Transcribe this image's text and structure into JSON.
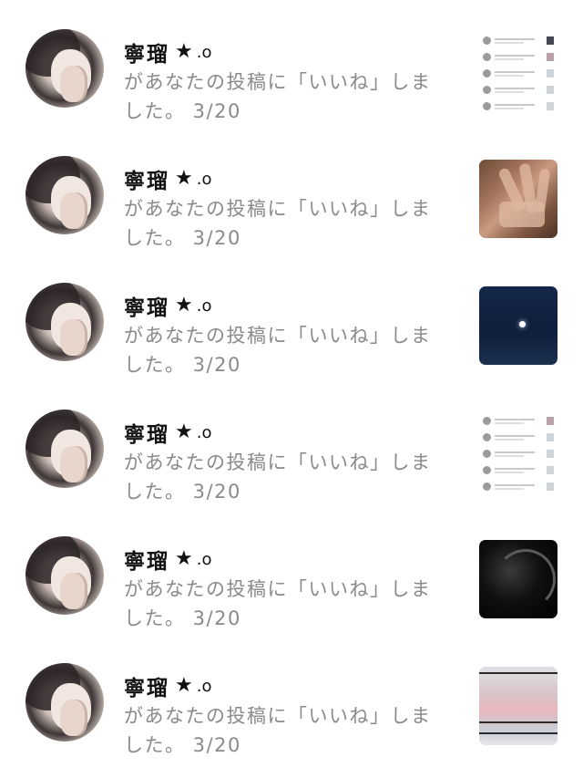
{
  "notifications": [
    {
      "name": "寧瑠",
      "star": "★",
      "deco": ".o",
      "message": "があなたの投稿に「いいね」しました。 3/20",
      "thumbnail": "screenshot"
    },
    {
      "name": "寧瑠",
      "star": "★",
      "deco": ".o",
      "message": "があなたの投稿に「いいね」しました。 3/20",
      "thumbnail": "hand-photo"
    },
    {
      "name": "寧瑠",
      "star": "★",
      "deco": ".o",
      "message": "があなたの投稿に「いいね」しました。 3/20",
      "thumbnail": "night-sky"
    },
    {
      "name": "寧瑠",
      "star": "★",
      "deco": ".o",
      "message": "があなたの投稿に「いいね」しました。 3/20",
      "thumbnail": "screenshot"
    },
    {
      "name": "寧瑠",
      "star": "★",
      "deco": ".o",
      "message": "があなたの投稿に「いいね」しました。 3/20",
      "thumbnail": "dark-abstract"
    },
    {
      "name": "寧瑠",
      "star": "★",
      "deco": ".o",
      "message": "があなたの投稿に「いいね」しました。 3/20",
      "thumbnail": "pink-sky"
    }
  ],
  "icons": {
    "avatar": "avatar-photo",
    "star": "star-icon"
  },
  "colors": {
    "name": "#111111",
    "message": "#8a8a8a",
    "background": "#ffffff"
  }
}
